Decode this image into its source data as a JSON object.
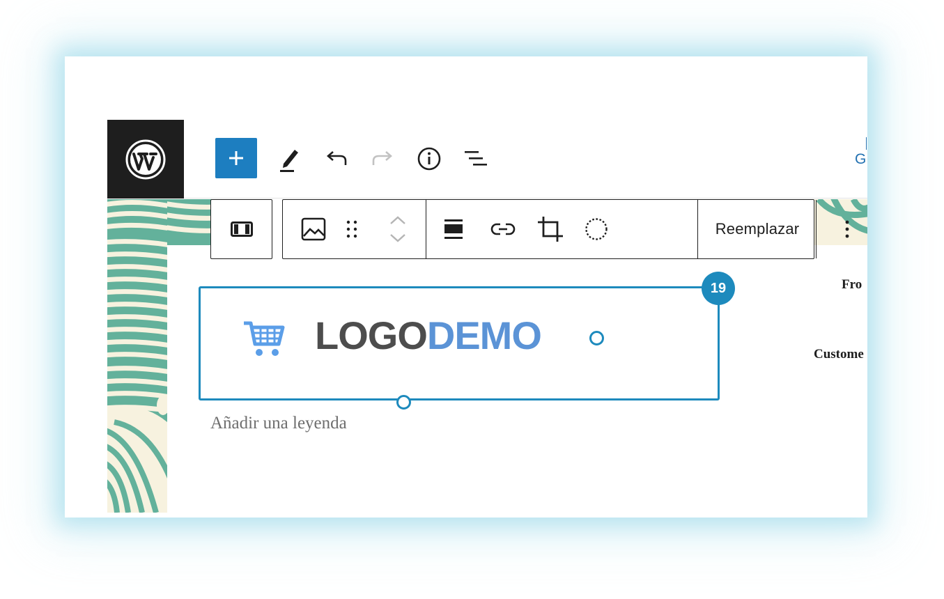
{
  "header": {
    "edge_text": "G"
  },
  "block_toolbar": {
    "replace_label": "Reemplazar"
  },
  "image_block": {
    "logo_part_1": "LOGO",
    "logo_part_2": "DEMO",
    "badge": "19",
    "caption_placeholder": "Añadir una leyenda"
  },
  "side_content": {
    "label_1": "Fro",
    "label_2": "Custome"
  },
  "icons": [
    "wordpress-logo-icon",
    "plus-icon",
    "pencil-icon",
    "undo-icon",
    "redo-icon",
    "info-icon",
    "list-view-icon",
    "block-type-icon",
    "image-icon",
    "drag-handle-icon",
    "chevron-up-icon",
    "chevron-down-icon",
    "align-icon",
    "link-icon",
    "crop-icon",
    "duotone-icon",
    "more-options-icon",
    "cart-icon"
  ],
  "colors": {
    "accent": "#1d8abd",
    "wp_blue": "#1d7ec0",
    "pattern_green": "#63b19b",
    "pattern_cream": "#f7f2df"
  }
}
